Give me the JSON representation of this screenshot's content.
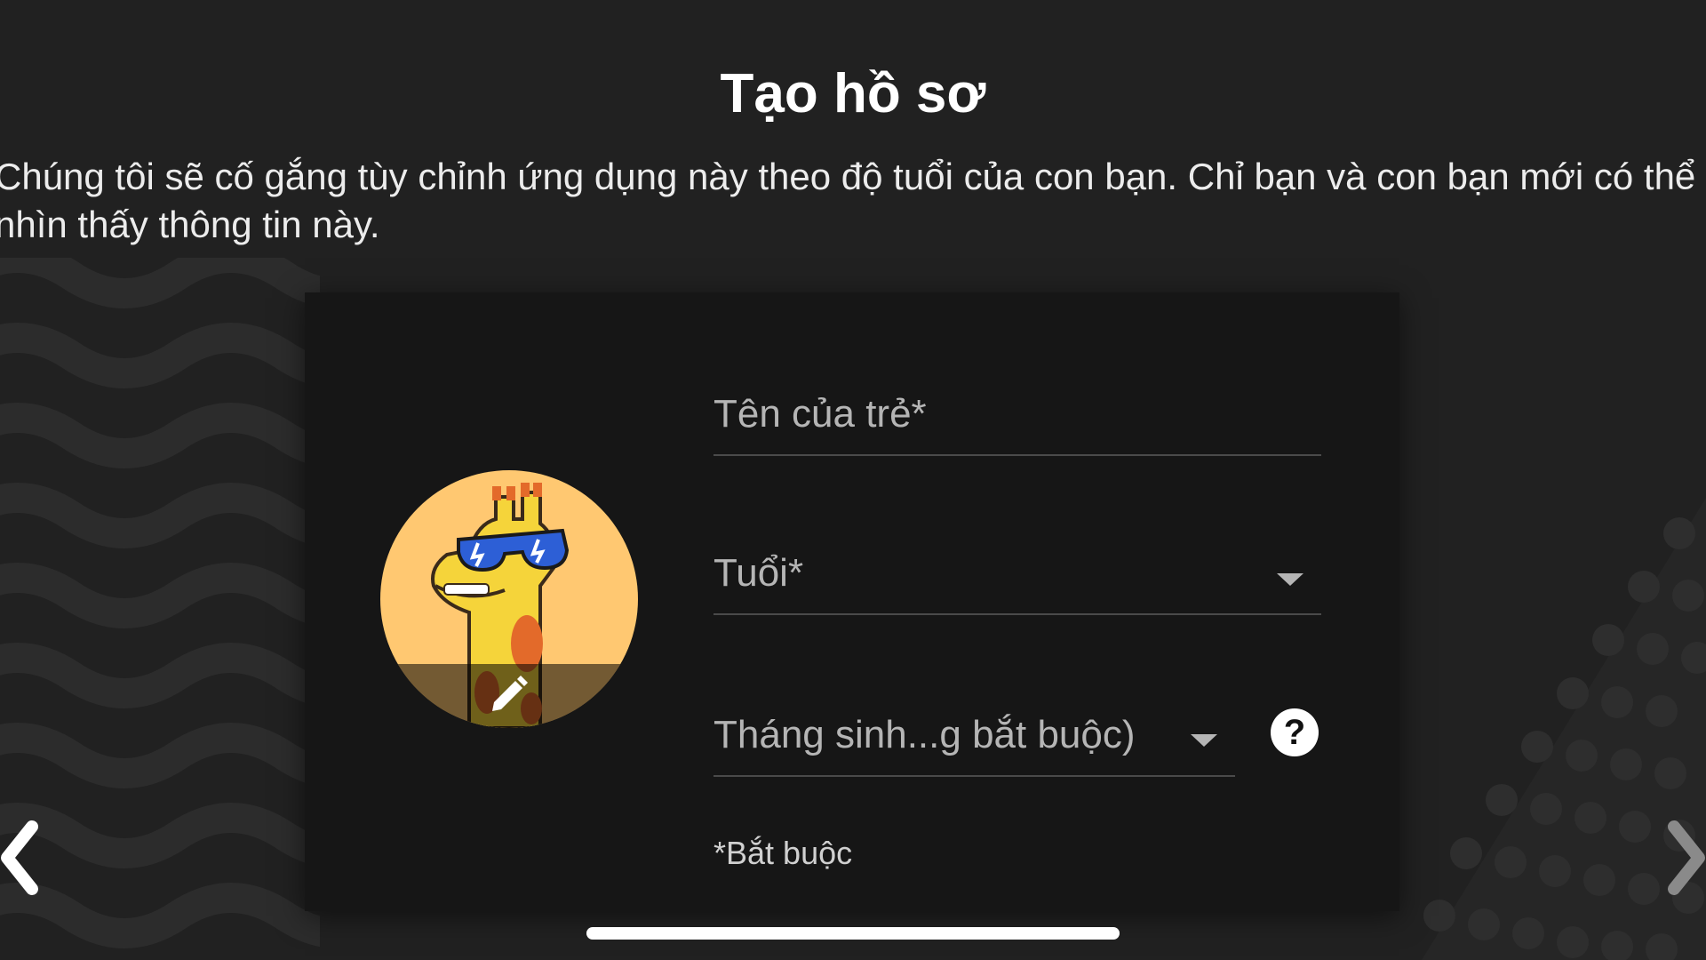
{
  "header": {
    "title": "Tạo hồ sơ",
    "description": "Chúng tôi sẽ cố gắng tùy chỉnh ứng dụng này theo độ tuổi của con bạn. Chỉ bạn và con bạn mới có thể nhìn thấy thông tin này."
  },
  "form": {
    "avatar_icon": "giraffe-with-sunglasses-avatar",
    "edit_icon": "pencil-icon",
    "name_placeholder": "Tên của trẻ*",
    "age_placeholder": "Tuổi*",
    "birth_month_placeholder": "Tháng sinh...g bắt buộc)",
    "help_symbol": "?",
    "required_note": "*Bắt buộc"
  },
  "navigation": {
    "back_icon": "chevron-left-icon",
    "forward_icon": "chevron-right-icon"
  },
  "colors": {
    "background": "#212121",
    "card": "#161616",
    "avatar_bg": "#FFC871",
    "field_text": "#B5B5B5"
  }
}
